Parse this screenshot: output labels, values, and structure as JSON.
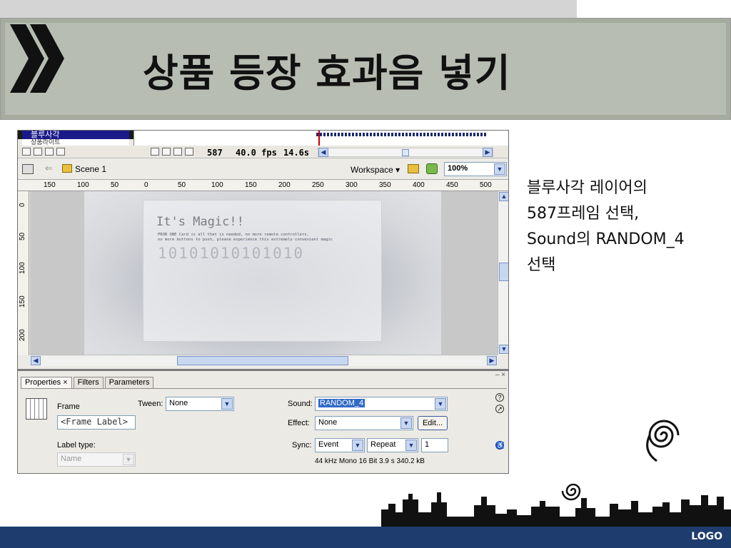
{
  "slide": {
    "title": "상품 등장 효과음 넣기",
    "description": [
      "블루사각 레이어의",
      "587프레임 선택,",
      "Sound의 RANDOM_4",
      "선택"
    ],
    "footer_logo": "LOGO"
  },
  "timeline": {
    "layer_active": "블루사각",
    "layer_next": "상품라이트",
    "frame": "587",
    "fps": "40.0 fps",
    "time": "14.6s"
  },
  "editbar": {
    "scene": "Scene 1",
    "workspace": "Workspace ▾",
    "zoom": "100%"
  },
  "rulers": {
    "top": [
      "150",
      "100",
      "50",
      "0",
      "50",
      "100",
      "150",
      "200",
      "250",
      "300",
      "350",
      "400",
      "450",
      "500"
    ],
    "left": [
      "0",
      "50",
      "100",
      "150",
      "200"
    ]
  },
  "stage": {
    "card_title": "It's Magic!!",
    "card_line1": "PROB ONE Card is all that is needed, no more remote controllers,",
    "card_line2": "no more buttons to push, please experience this extremely convenient magic",
    "binary": "10101010101010"
  },
  "properties": {
    "tabs": [
      "Properties",
      "Filters",
      "Parameters"
    ],
    "frame_type": "Frame",
    "frame_label": "<Frame Label>",
    "label_type_label": "Label type:",
    "label_type_value": "Name",
    "tween_label": "Tween:",
    "tween_value": "None",
    "sound_label": "Sound:",
    "sound_value": "RANDOM_4",
    "effect_label": "Effect:",
    "effect_value": "None",
    "edit_button": "Edit...",
    "sync_label": "Sync:",
    "sync_value": "Event",
    "repeat_value": "Repeat",
    "repeat_count": "1",
    "sound_info": "44 kHz Mono 16 Bit 3.9 s 340.2 kB"
  }
}
